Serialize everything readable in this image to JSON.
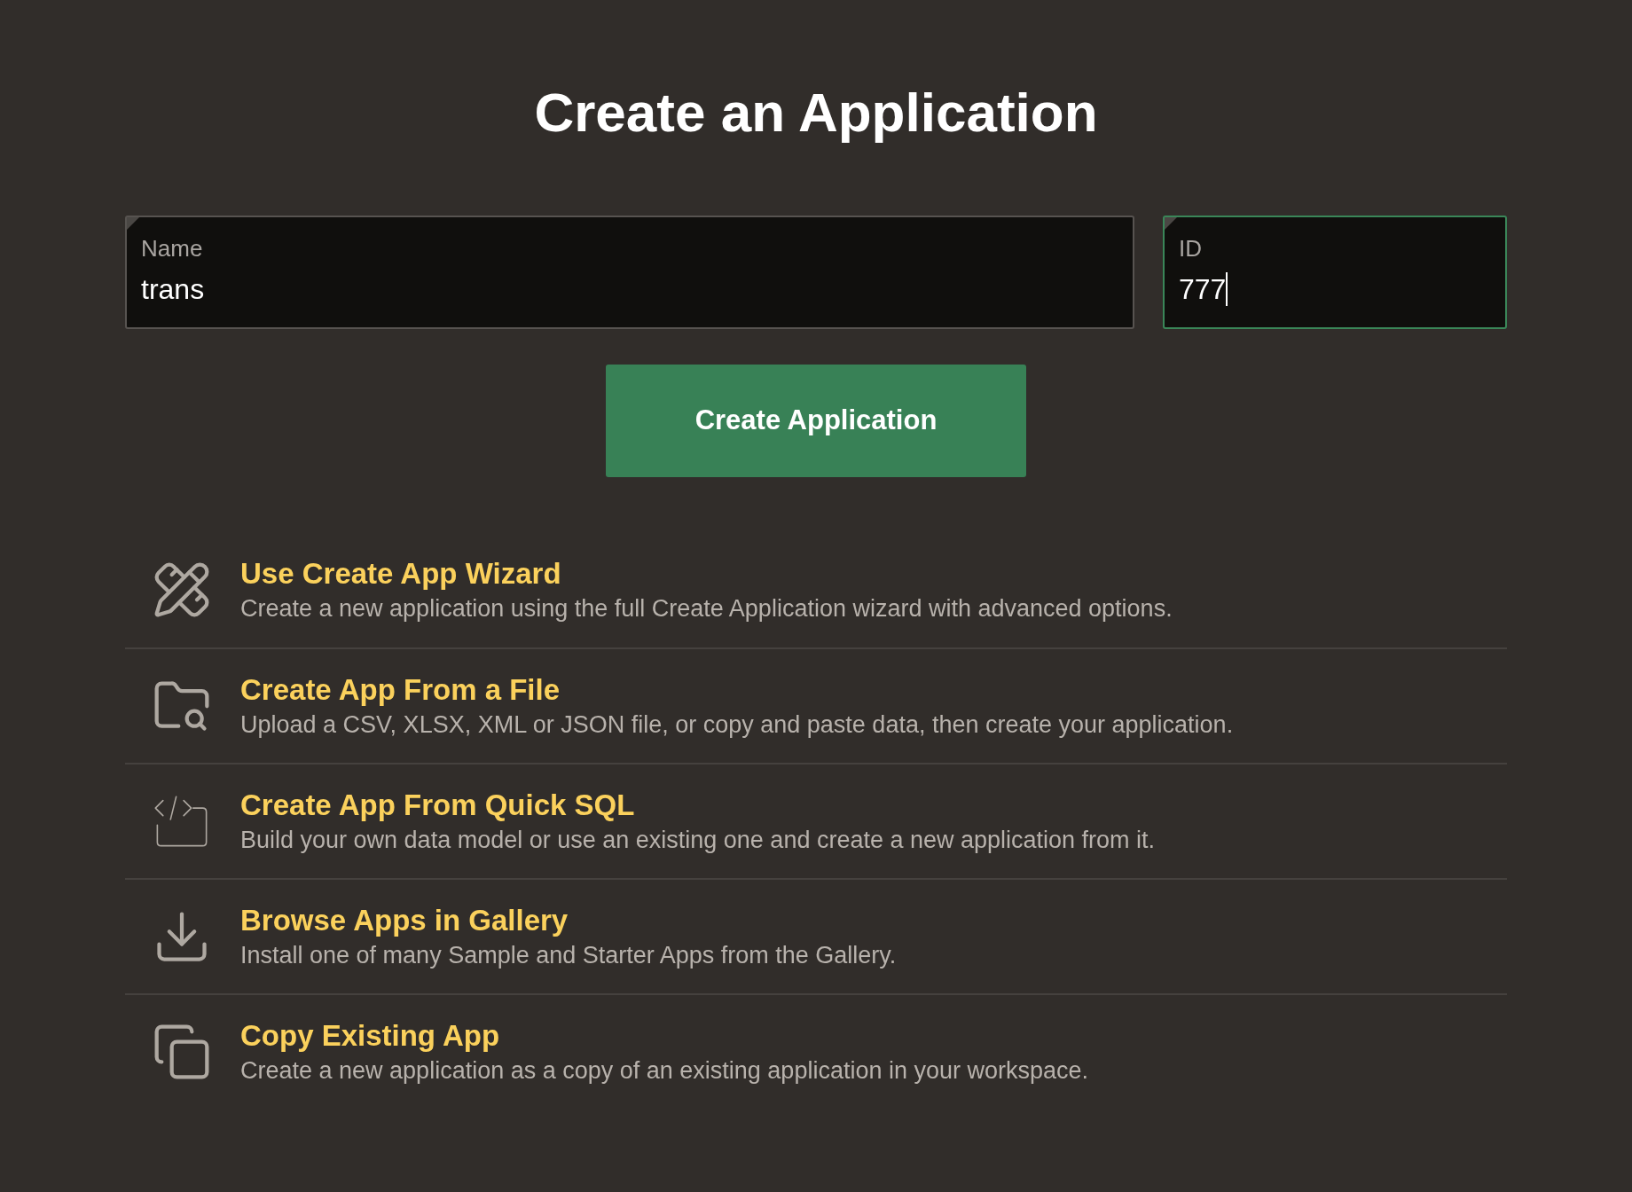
{
  "title": "Create an Application",
  "fields": [
    {
      "label": "Name",
      "value": "trans",
      "focused": false
    },
    {
      "label": "ID",
      "value": "777",
      "focused": true
    }
  ],
  "primary_button": "Create Application",
  "options": [
    {
      "kind": "wizard",
      "title": "Use Create App Wizard",
      "description": "Create a new application using the full Create Application wizard with advanced options."
    },
    {
      "kind": "file",
      "title": "Create App From a File",
      "description": "Upload a CSV, XLSX, XML or JSON file, or copy and paste data, then create your application."
    },
    {
      "kind": "sql",
      "title": "Create App From Quick SQL",
      "description": "Build your own data model or use an existing one and create a new application from it."
    },
    {
      "kind": "gallery",
      "title": "Browse Apps in Gallery",
      "description": "Install one of many Sample and Starter Apps from the Gallery."
    },
    {
      "kind": "copy",
      "title": "Copy Existing App",
      "description": "Create a new application as a copy of an existing application in your workspace."
    }
  ]
}
